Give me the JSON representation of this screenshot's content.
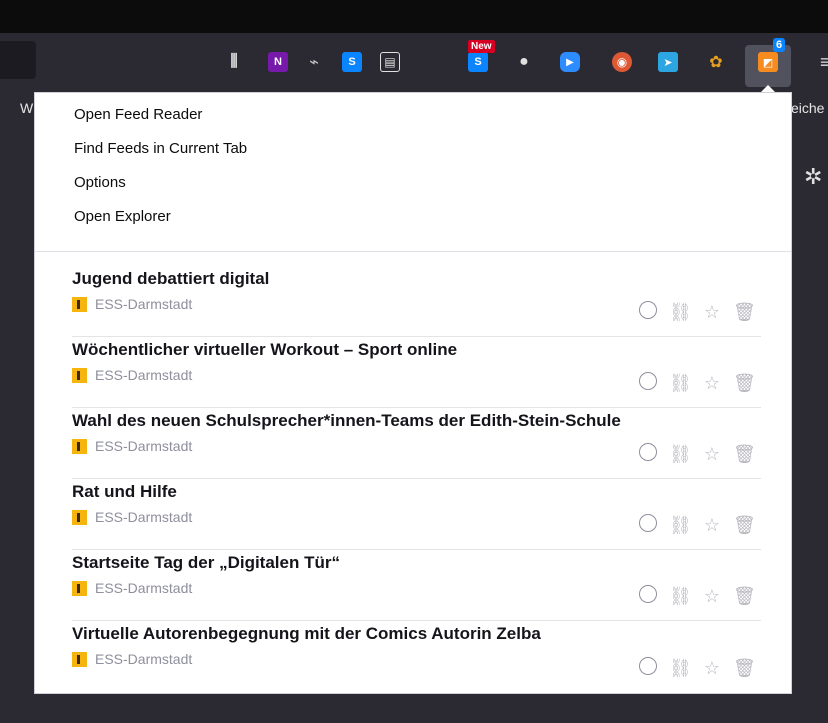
{
  "bookmarks": {
    "left_fragment": "W",
    "right_fragment": "eiche"
  },
  "toolbar": {
    "icons": [
      {
        "name": "library-icon",
        "glyph": "⫼"
      },
      {
        "name": "onenote-icon",
        "glyph": "N"
      },
      {
        "name": "shoe-icon",
        "glyph": "⌁"
      },
      {
        "name": "s-icon",
        "glyph": "S"
      },
      {
        "name": "reader-icon",
        "glyph": "▤"
      },
      {
        "name": "s-new-icon",
        "glyph": "S"
      },
      {
        "name": "account-icon",
        "glyph": "●"
      },
      {
        "name": "zoom-icon",
        "glyph": "▶"
      },
      {
        "name": "duckduckgo-icon",
        "glyph": "◉"
      },
      {
        "name": "telegram-icon",
        "glyph": "➤"
      },
      {
        "name": "pei-icon",
        "glyph": "✿"
      },
      {
        "name": "feed-reader-icon",
        "glyph": "◩"
      }
    ],
    "new_badge": "New",
    "count_badge": "6",
    "colors": {
      "onenote": "#7719aa",
      "s": "#0a84ff",
      "zoom": "#2d8cff",
      "duck": "#de5833",
      "telegram": "#2ca5e0",
      "feed": "#f68c1f"
    }
  },
  "menu": {
    "items": [
      "Open Feed Reader",
      "Find Feeds in Current Tab",
      "Options",
      "Open Explorer"
    ]
  },
  "feeds": [
    {
      "title": "Jugend debattiert digital",
      "source": "ESS-Darmstadt"
    },
    {
      "title": "Wöchentlicher virtueller Workout – Sport online",
      "source": "ESS-Darmstadt"
    },
    {
      "title": "Wahl des neuen Schulsprecher*innen-Teams der Edith-Stein-Schule",
      "source": "ESS-Darmstadt"
    },
    {
      "title": "Rat und Hilfe",
      "source": "ESS-Darmstadt"
    },
    {
      "title": "Startseite Tag der „Digitalen Tür“",
      "source": "ESS-Darmstadt"
    },
    {
      "title": "Virtuelle Autorenbegegnung mit der Comics Autorin Zelba",
      "source": "ESS-Darmstadt"
    }
  ],
  "actions": {
    "link_glyph": "⛓",
    "star_glyph": "☆",
    "trash_glyph": "🗑"
  }
}
